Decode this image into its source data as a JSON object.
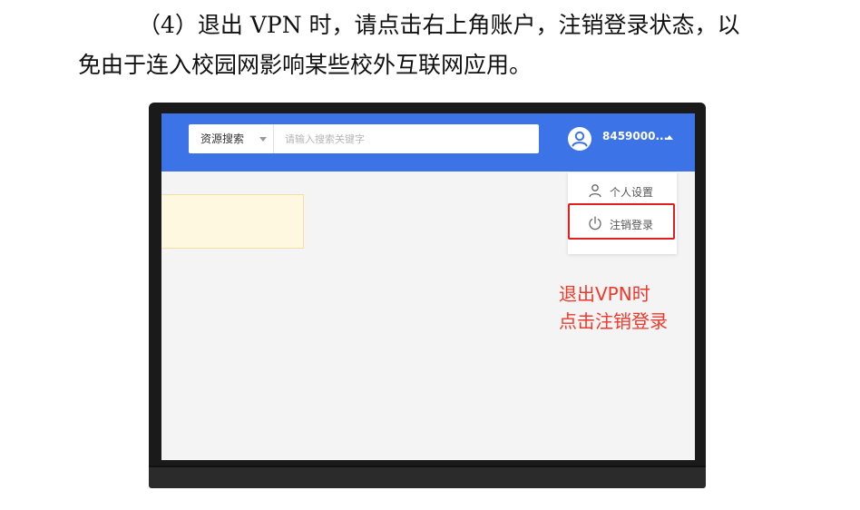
{
  "document": {
    "paragraph_line1": "（4）退出 VPN 时，请点击右上角账户，注销登录状态，以",
    "paragraph_line2": "免由于连入校园网影响某些校外互联网应用。"
  },
  "screenshot": {
    "search": {
      "scope_label": "资源搜索",
      "placeholder": "请输入搜索关键字",
      "value": ""
    },
    "account": {
      "username": "8459000..."
    },
    "dropdown": {
      "items": [
        {
          "label": "个人设置",
          "icon": "user-icon"
        },
        {
          "label": "注销登录",
          "icon": "power-icon"
        }
      ]
    },
    "annotation": {
      "line1": "退出VPN时",
      "line2": "点击注销登录"
    }
  },
  "colors": {
    "topbar": "#3c73e6",
    "annotation": "#f0382b",
    "highlight_border": "#e02020",
    "banner": "#fff8e1"
  }
}
